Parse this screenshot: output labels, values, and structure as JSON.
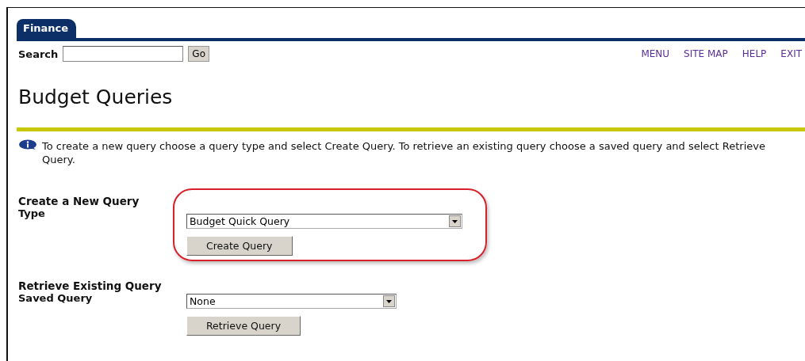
{
  "tabs": [
    {
      "label": "Finance",
      "selected": true
    }
  ],
  "search": {
    "label": "Search",
    "button": "Go"
  },
  "nav_links": [
    "MENU",
    "SITE MAP",
    "HELP",
    "EXIT"
  ],
  "title": "Budget Queries",
  "info": "To create a new query choose a query type and select Create Query. To retrieve an existing query choose a saved query and select Retrieve Query.",
  "sections": [
    {
      "heading": "Create a New Query",
      "label": "Type",
      "value": "Budget Quick Query",
      "button": "Create Query",
      "highlighted": true
    },
    {
      "heading": "Retrieve Existing Query",
      "label": "Saved Query",
      "value": "None",
      "button": "Retrieve Query",
      "highlighted": false
    }
  ]
}
